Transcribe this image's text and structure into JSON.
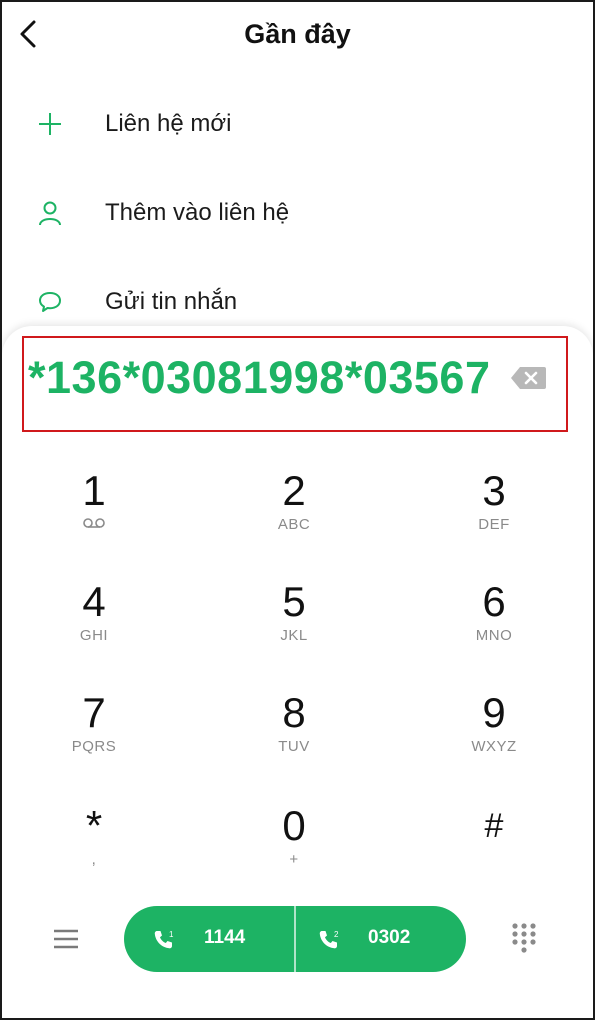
{
  "header": {
    "title": "Gần đây"
  },
  "actions": [
    {
      "label": "Liên hệ mới",
      "icon": "plus-icon"
    },
    {
      "label": "Thêm vào liên hệ",
      "icon": "person-icon"
    },
    {
      "label": "Gửi tin nhắn",
      "icon": "chat-bubble-icon"
    }
  ],
  "dialer": {
    "number": "*136*03081998*03567"
  },
  "keypad": [
    {
      "digit": "1",
      "sub": ""
    },
    {
      "digit": "2",
      "sub": "ABC"
    },
    {
      "digit": "3",
      "sub": "DEF"
    },
    {
      "digit": "4",
      "sub": "GHI"
    },
    {
      "digit": "5",
      "sub": "JKL"
    },
    {
      "digit": "6",
      "sub": "MNO"
    },
    {
      "digit": "7",
      "sub": "PQRS"
    },
    {
      "digit": "8",
      "sub": "TUV"
    },
    {
      "digit": "9",
      "sub": "WXYZ"
    },
    {
      "digit": "*",
      "sub": ","
    },
    {
      "digit": "0",
      "sub": "+"
    },
    {
      "digit": "#",
      "sub": ""
    }
  ],
  "call_bar": {
    "sim1": {
      "badge": "1",
      "label": "1144"
    },
    "sim2": {
      "badge": "2",
      "label": "0302"
    }
  },
  "colors": {
    "accent": "#1db364",
    "highlight_border": "#d0191c"
  }
}
